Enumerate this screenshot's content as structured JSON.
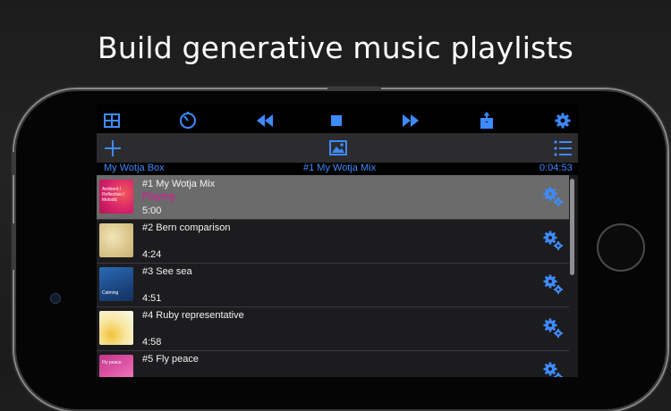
{
  "headline": "Build generative music playlists",
  "colors": {
    "accent": "#3d8bff",
    "playing": "#e0159a",
    "selected_row": "#6b6b6b"
  },
  "toolbar": {
    "icons": [
      "grid-icon",
      "timer-icon",
      "rewind-icon",
      "stop-icon",
      "fast-forward-icon",
      "share-icon",
      "settings-gear-icon"
    ]
  },
  "actionbar": {
    "icons": [
      "add-icon",
      "image-icon",
      "list-icon"
    ]
  },
  "info": {
    "box": "My Wotja Box",
    "mix": "#1 My Wotja Mix",
    "time": "0:04:53"
  },
  "tracks": [
    {
      "title": "#1 My Wotja Mix",
      "status": "Playing",
      "duration": "5:00",
      "thumb_text": "Ambient / Reflective / Melodic",
      "thumb_color": "#e0306a"
    },
    {
      "title": "#2 Bern comparison",
      "status": "",
      "duration": "4:24",
      "thumb_text": "",
      "thumb_color": "#d8c98c"
    },
    {
      "title": "#3 See sea",
      "status": "",
      "duration": "4:51",
      "thumb_text": "Calming",
      "thumb_color": "#1f4f8a"
    },
    {
      "title": "#4 Ruby representative",
      "status": "",
      "duration": "4:58",
      "thumb_text": "",
      "thumb_color": "#f2f2e8"
    },
    {
      "title": "#5 Fly peace",
      "status": "",
      "duration": "",
      "thumb_text": "Fly peace",
      "thumb_color": "#d94fa0"
    }
  ]
}
